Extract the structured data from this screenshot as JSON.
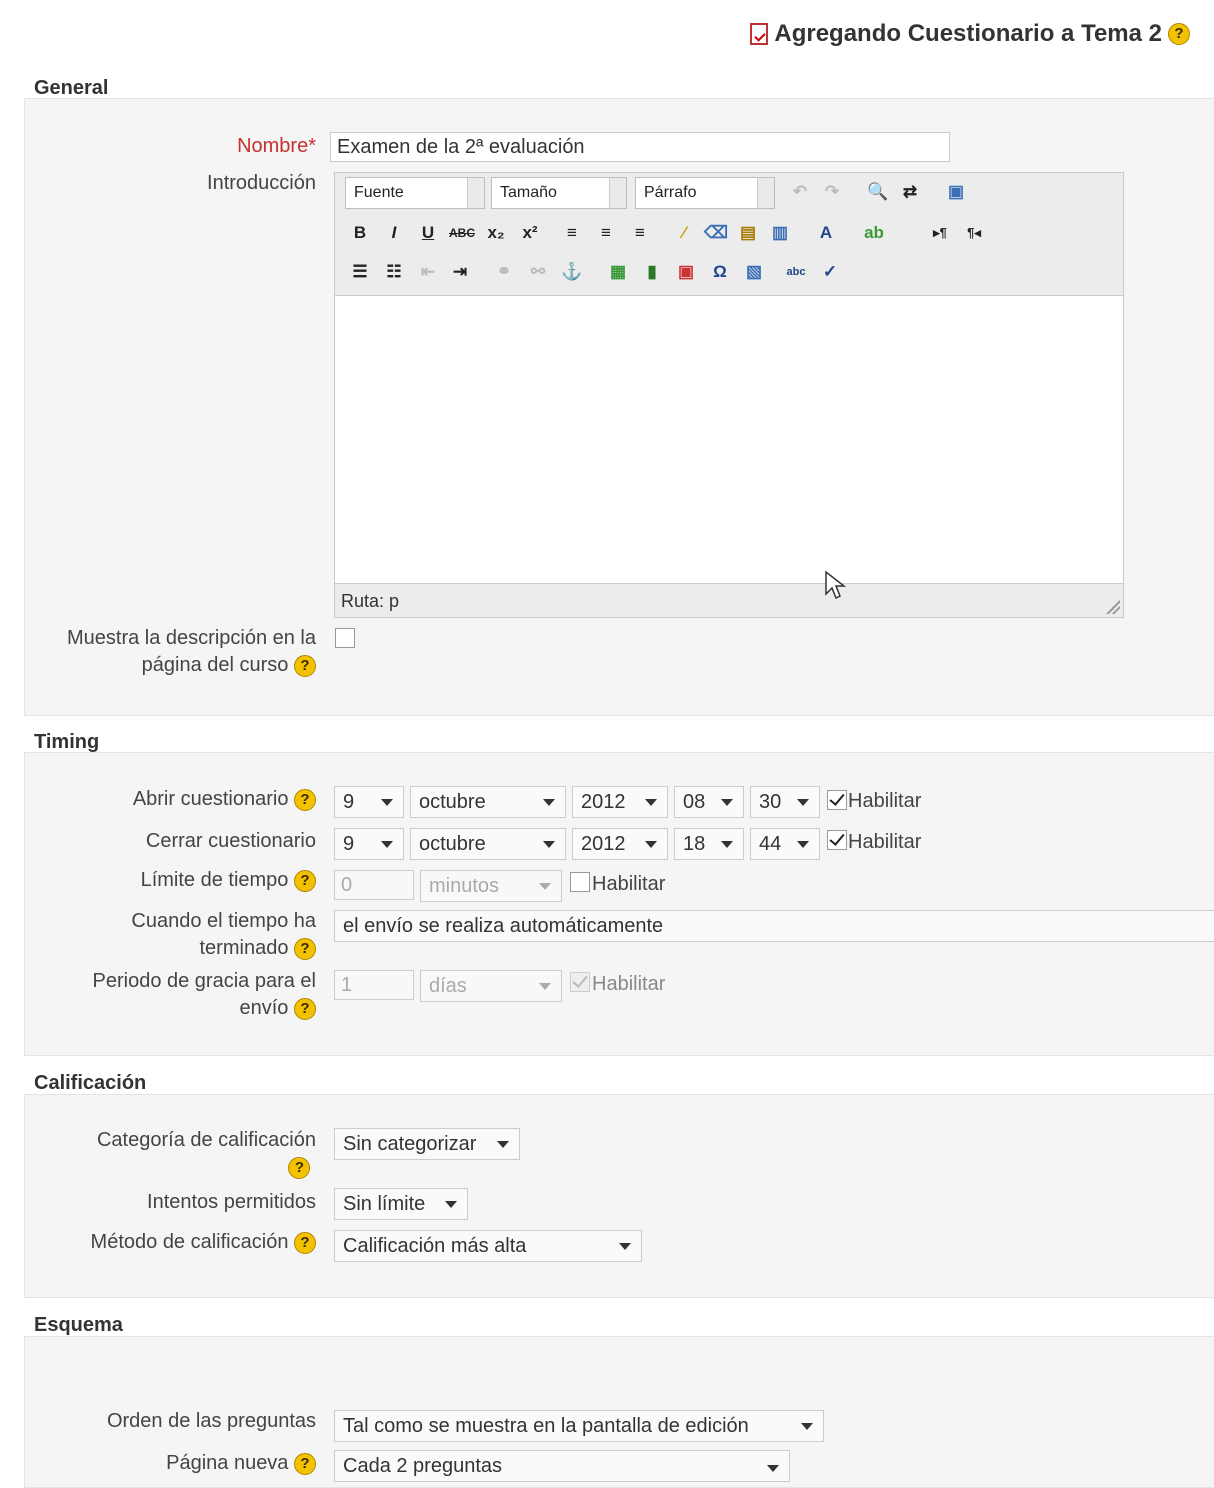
{
  "page_title": "Agregando Cuestionario a Tema 2",
  "sections": {
    "general": {
      "legend": "General",
      "nombre_label": "Nombre",
      "required_mark": "*",
      "nombre_value": "Examen de la 2ª evaluación",
      "intro_label": "Introducción",
      "editor": {
        "font_select": "Fuente",
        "size_select": "Tamaño",
        "format_select": "Párrafo",
        "status_path": "Ruta: p"
      },
      "show_desc_label_1": "Muestra la descripción en la",
      "show_desc_label_2": "página del curso"
    },
    "timing": {
      "legend": "Timing",
      "open_label": "Abrir cuestionario",
      "open": {
        "day": "9",
        "month": "octubre",
        "year": "2012",
        "hour": "08",
        "minute": "30",
        "enable": "Habilitar"
      },
      "close_label": "Cerrar cuestionario",
      "close": {
        "day": "9",
        "month": "octubre",
        "year": "2012",
        "hour": "18",
        "minute": "44",
        "enable": "Habilitar"
      },
      "limit_label": "Límite de tiempo",
      "limit_value": "0",
      "limit_unit": "minutos",
      "limit_enable": "Habilitar",
      "when_label_1": "Cuando el tiempo ha",
      "when_label_2": "terminado",
      "when_value": "el envío se realiza automáticamente",
      "grace_label_1": "Periodo de gracia para el",
      "grace_label_2": "envío",
      "grace_value": "1",
      "grace_unit": "días",
      "grace_enable": "Habilitar"
    },
    "grade": {
      "legend": "Calificación",
      "category_label": "Categoría de calificación",
      "category_value": "Sin categorizar",
      "attempts_label": "Intentos permitidos",
      "attempts_value": "Sin límite",
      "method_label": "Método de calificación",
      "method_value": "Calificación más alta"
    },
    "layout": {
      "legend": "Esquema",
      "order_label": "Orden de las preguntas",
      "order_value": "Tal como se muestra en la pantalla de edición",
      "newpage_label": "Página nueva",
      "newpage_value": "Cada 2 preguntas"
    }
  },
  "icons": {
    "help": "?"
  },
  "colors": {
    "required": "#c5312d",
    "help_badge": "#f2c200"
  }
}
